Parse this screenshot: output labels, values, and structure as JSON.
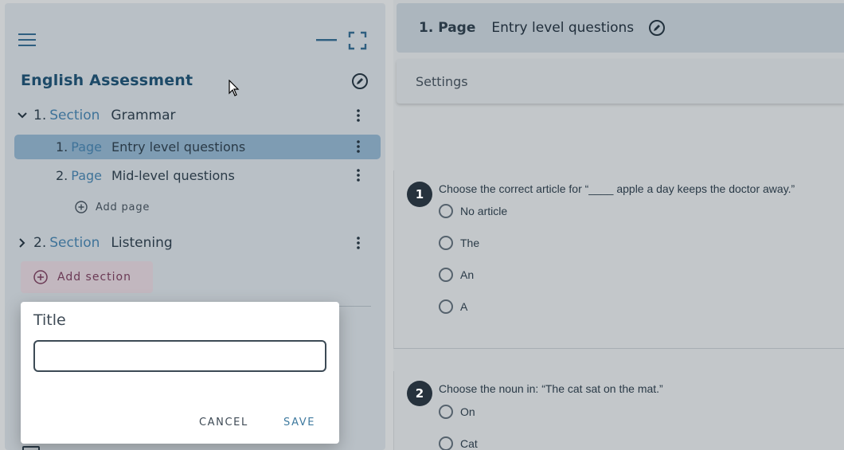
{
  "sidebar": {
    "assessment_title": "English Assessment",
    "sections": [
      {
        "number": "1.",
        "keyword": "Section",
        "name": "Grammar",
        "expanded": true,
        "pages": [
          {
            "number": "1.",
            "keyword": "Page",
            "name": "Entry level questions",
            "selected": true
          },
          {
            "number": "2.",
            "keyword": "Page",
            "name": "Mid-level questions",
            "selected": false
          }
        ],
        "add_page_label": "Add page"
      },
      {
        "number": "2.",
        "keyword": "Section",
        "name": "Listening",
        "expanded": false
      }
    ],
    "add_section_label": "Add section"
  },
  "dialog": {
    "title": "Title",
    "input_value": "",
    "cancel_label": "CANCEL",
    "save_label": "SAVE"
  },
  "main": {
    "page_number": "1. Page",
    "page_title": "Entry level questions",
    "settings_label": "Settings",
    "questions": [
      {
        "number": "1",
        "text": "Choose the correct article for “____ apple a day keeps the doctor away.”",
        "options": [
          "No article",
          "The",
          "An",
          "A"
        ]
      },
      {
        "number": "2",
        "text": "Choose the noun in: “The cat sat on the mat.”",
        "options": [
          "On",
          "Cat"
        ]
      }
    ]
  },
  "colors": {
    "accent": "#3f7399",
    "selected_row": "#7e9cb3",
    "add_section_bg": "#c2b7bf",
    "add_section_text": "#6b3a55",
    "badge": "#26323d"
  }
}
